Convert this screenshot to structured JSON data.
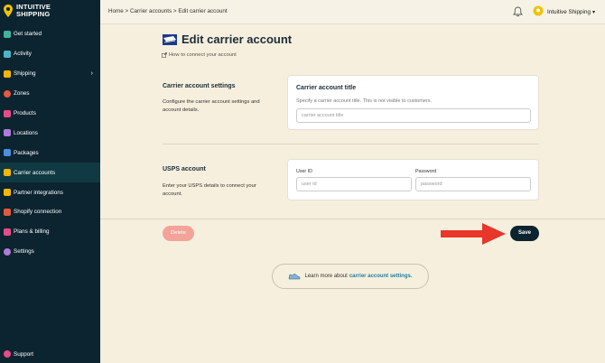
{
  "brand": {
    "line1": "INTUITIVE",
    "line2": "SHIPPING"
  },
  "sidebar": {
    "items": [
      {
        "label": "Get started",
        "icon": "hand-icon",
        "color": "#3fb39b"
      },
      {
        "label": "Activity",
        "icon": "activity-icon",
        "color": "#4fb3c7"
      },
      {
        "label": "Shipping",
        "icon": "shipping-icon",
        "color": "#f2b705",
        "chevron": "›"
      },
      {
        "label": "Zones",
        "icon": "globe-icon",
        "color": "#e8573f"
      },
      {
        "label": "Products",
        "icon": "shirt-icon",
        "color": "#e84a8a"
      },
      {
        "label": "Locations",
        "icon": "building-icon",
        "color": "#b07ad9"
      },
      {
        "label": "Packages",
        "icon": "packages-icon",
        "color": "#4d8fe0"
      },
      {
        "label": "Carrier accounts",
        "icon": "key-icon",
        "color": "#f2b705"
      },
      {
        "label": "Partner integrations",
        "icon": "integrations-icon",
        "color": "#f2b705"
      },
      {
        "label": "Shopify connection",
        "icon": "shopify-icon",
        "color": "#e8573f"
      },
      {
        "label": "Plans & billing",
        "icon": "card-icon",
        "color": "#e84a8a"
      },
      {
        "label": "Settings",
        "icon": "gear-icon",
        "color": "#b07ad9"
      }
    ],
    "support": "Support"
  },
  "topbar": {
    "breadcrumb": "Home > Carrier accounts > Edit carrier account",
    "profile": "Intuitive Shipping",
    "profile_caret": "▾"
  },
  "page": {
    "title": "Edit carrier account",
    "help_link": "How to connect your account"
  },
  "settings_section": {
    "title": "Carrier account settings",
    "description": "Configure the carrier account settings and account details.",
    "card_title": "Carrier account title",
    "card_hint": "Specify a carrier account title. This is not visible to customers.",
    "input_placeholder": "carrier account title"
  },
  "usps_section": {
    "title": "USPS account",
    "description": "Enter your USPS details to connect your account.",
    "user_id_label": "User ID",
    "user_id_placeholder": "user id",
    "password_label": "Password",
    "password_placeholder": "password"
  },
  "actions": {
    "delete": "Delete",
    "save": "Save"
  },
  "learn_more": {
    "prefix": "Learn more about",
    "link": "carrier account settings."
  },
  "colors": {
    "sidebar_bg": "#0c2430",
    "page_bg": "#f6efdd",
    "accent_red": "#e8362a",
    "link": "#1f7ea3"
  }
}
